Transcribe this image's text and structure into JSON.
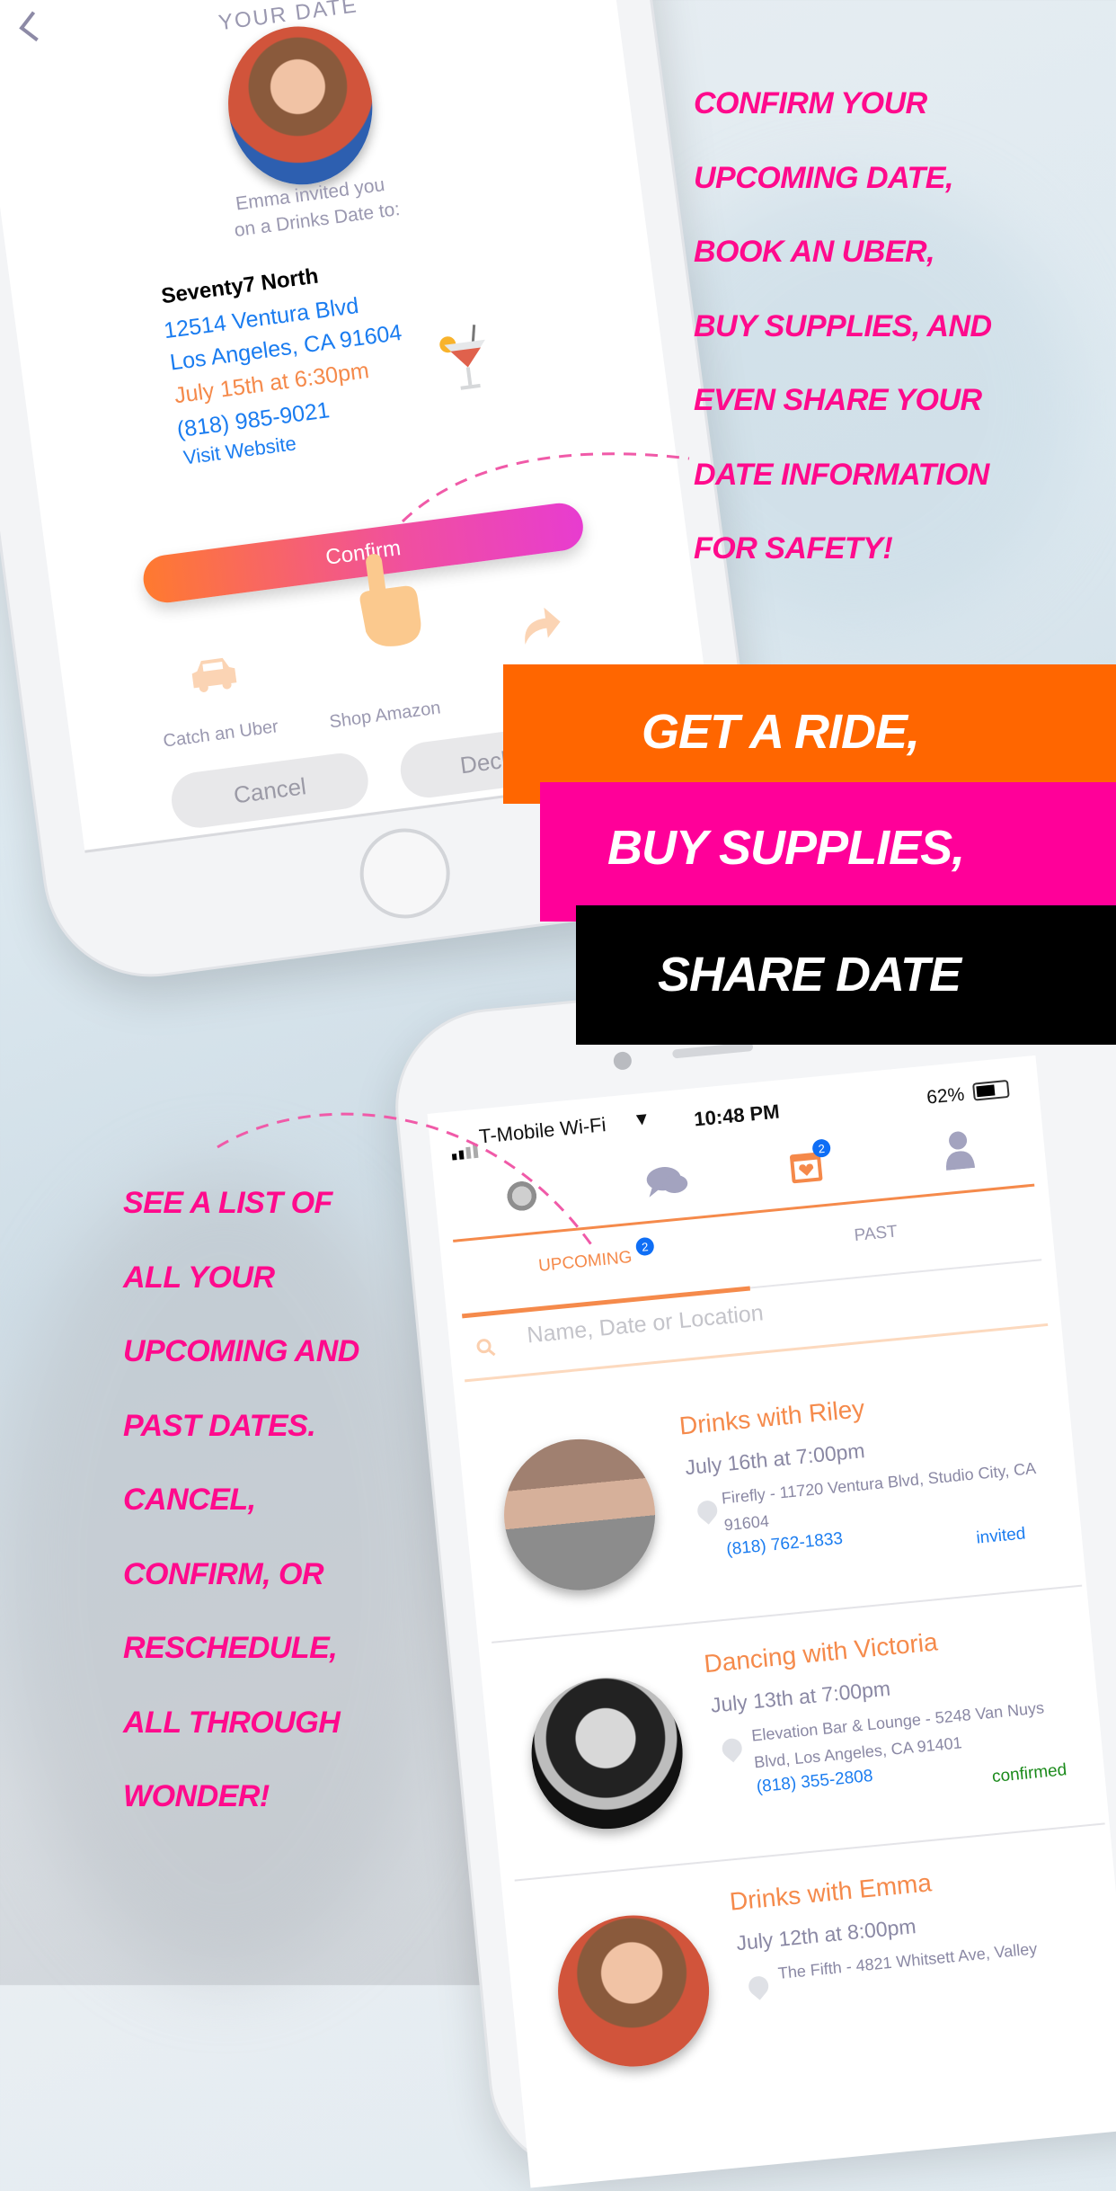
{
  "colors": {
    "magenta": "#ff0a8c",
    "orange_banner": "#ff6600",
    "pink_banner": "#ff0099",
    "black_banner": "#000000",
    "app_orange": "#f58a4b",
    "link_blue": "#1a7cf0",
    "confirmed_green": "#1a8a1a"
  },
  "promo_right": [
    "CONFIRM YOUR",
    "UPCOMING DATE,",
    "BOOK AN UBER,",
    "BUY SUPPLIES,  AND",
    "EVEN SHARE YOUR",
    "DATE INFORMATION",
    "FOR SAFETY!"
  ],
  "banners": [
    "GET A RIDE,",
    "BUY SUPPLIES,",
    "SHARE DATE"
  ],
  "promo_left": [
    "SEE A LIST OF",
    "ALL YOUR",
    "UPCOMING AND",
    "PAST DATES.",
    "CANCEL,",
    "CONFIRM, OR",
    "RESCHEDULE,",
    "ALL THROUGH",
    "WONDER!"
  ],
  "invite": {
    "header": "YOUR DATE",
    "invite_line1": "Emma invited you",
    "invite_line2": "on a Drinks Date to:",
    "venue": "Seventy7 North",
    "address1": "12514 Ventura Blvd",
    "address2": "Los Angeles, CA 91604",
    "datetime": "July 15th at 6:30pm",
    "phone": "(818) 985-9021",
    "website": "Visit Website",
    "confirm_label": "Confirm",
    "uber_label": "Catch an Uber",
    "amazon_label": "Shop Amazon",
    "cancel_label": "Cancel",
    "decline_label": "Decline",
    "icons": [
      "back-chevron-icon",
      "cocktail-icon",
      "pointing-hand-icon",
      "car-icon",
      "share-arrow-icon"
    ]
  },
  "list": {
    "status_bar": {
      "carrier": "T-Mobile Wi-Fi",
      "time": "10:48 PM",
      "battery": "62%",
      "battery_level": 0.62
    },
    "nav_icons": [
      "sun-icon",
      "chat-icon",
      "calendar-heart-icon",
      "profile-icon"
    ],
    "nav_badge": "2",
    "tabs": [
      {
        "label": "UPCOMING",
        "badge": "2",
        "active": true
      },
      {
        "label": "PAST",
        "active": false
      }
    ],
    "search_placeholder": "Name, Date or Location",
    "dates": [
      {
        "title": "Drinks with Riley",
        "when": "July 16th at 7:00pm",
        "address": "Firefly - 11720 Ventura Blvd, Studio City, CA 91604",
        "phone": "(818) 762-1833",
        "status": "invited"
      },
      {
        "title": "Dancing with Victoria",
        "when": "July 13th at 7:00pm",
        "address": "Elevation Bar & Lounge - 5248 Van Nuys Blvd, Los Angeles, CA 91401",
        "phone": "(818) 355-2808",
        "status": "confirmed"
      },
      {
        "title": "Drinks with Emma",
        "when": "July 12th at 8:00pm",
        "address": "The Fifth - 4821 Whitsett Ave, Valley"
      }
    ]
  }
}
